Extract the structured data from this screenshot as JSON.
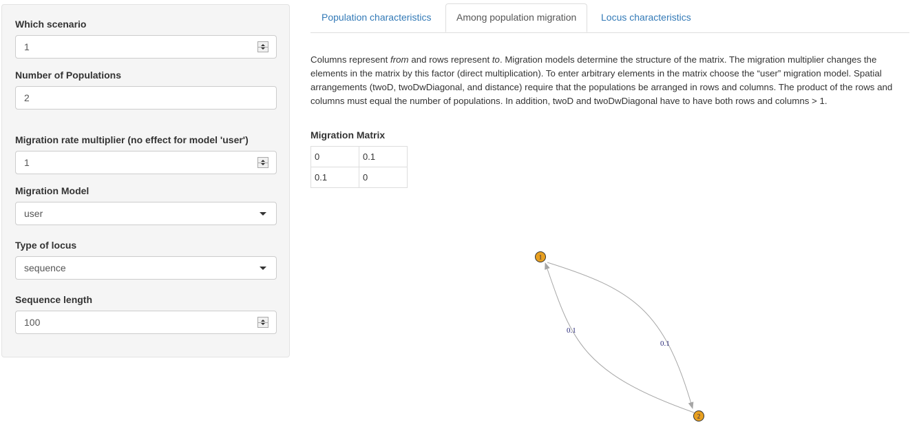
{
  "sidebar": {
    "scenario": {
      "label": "Which scenario",
      "value": "1"
    },
    "num_populations": {
      "label": "Number of Populations",
      "value": "2"
    },
    "migration_multiplier": {
      "label": "Migration rate multiplier (no effect for model 'user')",
      "value": "1"
    },
    "migration_model": {
      "label": "Migration Model",
      "value": "user"
    },
    "locus_type": {
      "label": "Type of locus",
      "value": "sequence"
    },
    "sequence_length": {
      "label": "Sequence length",
      "value": "100"
    }
  },
  "tabs": [
    {
      "label": "Population characteristics",
      "active": false
    },
    {
      "label": "Among population migration",
      "active": true
    },
    {
      "label": "Locus characteristics",
      "active": false
    }
  ],
  "description": {
    "part1": "Columns represent ",
    "from": "from",
    "part2": " and rows represent ",
    "to": "to",
    "part3": ". Migration models determine the structure of the matrix. The migration multiplier changes the elements in the matrix by this factor (direct multiplication). To enter arbitrary elements in the matrix choose the “user” migration model. Spatial arrangements (twoD, twoDwDiagonal, and distance) require that the populations be arranged in rows and columns. The product of the rows and columns must equal the number of populations. In addition, twoD and twoDwDiagonal have to have both rows and columns > 1."
  },
  "matrix": {
    "title": "Migration Matrix",
    "rows": [
      [
        "0",
        "0.1"
      ],
      [
        "0.1",
        "0"
      ]
    ]
  },
  "graph": {
    "nodes": [
      "1",
      "2"
    ],
    "edge_labels": [
      "0.1",
      "0.1"
    ],
    "node_color": "#e8a020",
    "edge_color": "#a6a6a6",
    "label_color": "#2a2a7a"
  }
}
